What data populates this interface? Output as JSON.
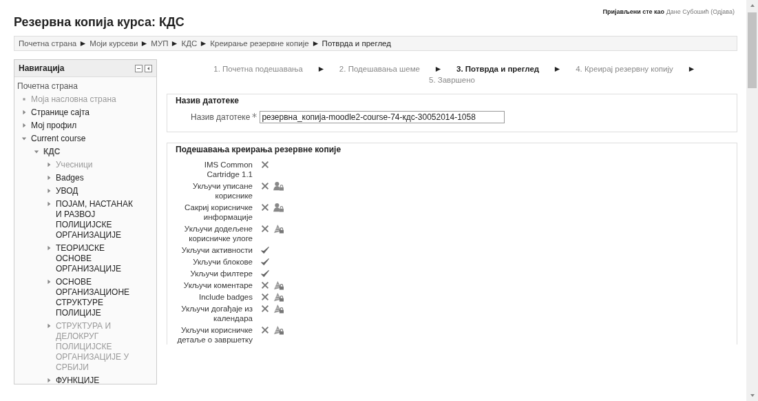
{
  "header": {
    "title": "Резервна копија курса: КДС",
    "login": {
      "prefix": "Пријављени сте као",
      "user": "Дане Субошић",
      "logout": "(Одјава)"
    }
  },
  "breadcrumb": [
    {
      "label": "Почетна страна",
      "current": false
    },
    {
      "label": "Моји курсеви",
      "current": false
    },
    {
      "label": "МУП",
      "current": false
    },
    {
      "label": "КДС",
      "current": false
    },
    {
      "label": "Креирање резервне копије",
      "current": false
    },
    {
      "label": "Потврда и преглед",
      "current": true
    }
  ],
  "navigation": {
    "title": "Навигација",
    "items": [
      {
        "label": "Почетна страна",
        "kind": "home",
        "dimmed": false
      },
      {
        "label": "Моја насловна страна",
        "kind": "leaf",
        "dimmed": true
      },
      {
        "label": "Странице сајта",
        "kind": "branch",
        "expanded": false,
        "dimmed": false
      },
      {
        "label": "Мој профил",
        "kind": "branch",
        "expanded": false,
        "dimmed": false
      },
      {
        "label": "Current course",
        "kind": "branch",
        "expanded": true,
        "dimmed": false,
        "children": [
          {
            "label": "КДС",
            "kind": "branch",
            "expanded": true,
            "dimmed": false,
            "children": [
              {
                "label": "Учесници",
                "kind": "branch",
                "expanded": false,
                "dimmed": true
              },
              {
                "label": "Badges",
                "kind": "branch",
                "expanded": false,
                "dimmed": false
              },
              {
                "label": "УВОД",
                "kind": "branch",
                "expanded": false,
                "dimmed": false
              },
              {
                "label": "ПОЈАМ, НАСТАНАК И РАЗВОЈ ПОЛИЦИЈСКЕ ОРГАНИЗАЦИЈЕ",
                "kind": "branch",
                "expanded": false,
                "dimmed": false
              },
              {
                "label": "ТЕОРИЈСКЕ ОСНОВЕ ОРГАНИЗАЦИЈЕ",
                "kind": "branch",
                "expanded": false,
                "dimmed": false
              },
              {
                "label": "ОСНОВЕ ОРГАНИЗАЦИОНЕ СТРУКТУРЕ ПОЛИЦИЈЕ",
                "kind": "branch",
                "expanded": false,
                "dimmed": false
              },
              {
                "label": "СТРУКТУРА И ДЕЛОКРУГ ПОЛИЦИЈСКЕ ОРГАНИЗАЦИЈЕ У СРБИЈИ",
                "kind": "branch",
                "expanded": false,
                "dimmed": true
              },
              {
                "label": "ФУНКЦИЈЕ",
                "kind": "branch",
                "expanded": false,
                "dimmed": false
              }
            ]
          }
        ]
      }
    ]
  },
  "steps": [
    {
      "label": "1. Почетна подешавања",
      "selected": false
    },
    {
      "label": "2. Подешавања шеме",
      "selected": false
    },
    {
      "label": "3. Потврда и преглед",
      "selected": true
    },
    {
      "label": "4. Креирај резервну копију",
      "selected": false
    },
    {
      "label": "5. Завршено",
      "selected": false
    }
  ],
  "filename_section": {
    "legend": "Назив датотеке",
    "label": "Назив датотеке",
    "required": true,
    "value": "резервна_копија-moodle2-course-74-кдс-30052014-1058"
  },
  "settings_section": {
    "legend": "Подешавања креирања резервне копије",
    "rows": [
      {
        "label": "IMS Common Cartridge 1.1",
        "checked": false,
        "kind": "plain"
      },
      {
        "label": "Укључи уписане кориснике",
        "checked": false,
        "kind": "user_locked"
      },
      {
        "label": "Сакриј корисничке информације",
        "checked": false,
        "kind": "user_locked"
      },
      {
        "label": "Укључи додељене корисничке улоге",
        "checked": false,
        "kind": "role_locked"
      },
      {
        "label": "Укључи активности",
        "checked": true,
        "kind": "plain"
      },
      {
        "label": "Укључи блокове",
        "checked": true,
        "kind": "plain"
      },
      {
        "label": "Укључи филтере",
        "checked": true,
        "kind": "plain"
      },
      {
        "label": "Укључи коментаре",
        "checked": false,
        "kind": "role_locked"
      },
      {
        "label": "Include badges",
        "checked": false,
        "kind": "role_locked"
      },
      {
        "label": "Укључи догађаје из календара",
        "checked": false,
        "kind": "role_locked"
      },
      {
        "label": "Укључи корисничке детаље о завршетку",
        "checked": false,
        "kind": "role_locked"
      }
    ]
  }
}
